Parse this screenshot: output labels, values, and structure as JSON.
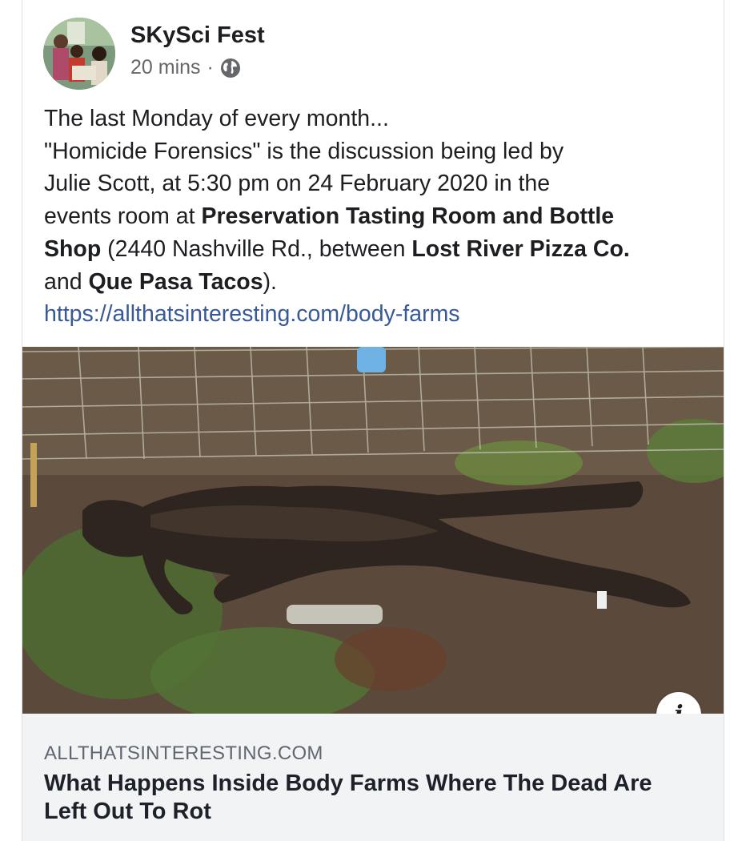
{
  "post": {
    "author": "SKySci Fest",
    "time": "20 mins",
    "separator": "·",
    "privacy_icon": "globe-icon",
    "text": {
      "line1": "The last Monday of every month...",
      "line2": "\"Homicide Forensics\" is the discussion being led by",
      "line3": "Julie Scott, at 5:30 pm on 24 February 2020 in the",
      "line4_prefix": "events room at ",
      "venue_part1": "Preservation Tasting Room and Bottle",
      "venue_part2": "Shop",
      "line5_mid": " (2440 Nashville Rd., between ",
      "place1": "Lost River Pizza Co.",
      "line6_prefix": "and ",
      "place2": "Que Pasa Tacos",
      "line6_suffix": ").",
      "url": "https://allthatsinteresting.com/body-farms"
    }
  },
  "link_preview": {
    "info_label": "i",
    "domain": "ALLTHATSINTERESTING.COM",
    "headline": "What Happens Inside Body Farms Where The Dead Are Left Out To Rot"
  },
  "colors": {
    "link": "#385898",
    "preview_bg": "#f2f3f5",
    "meta_text": "#65676b"
  }
}
